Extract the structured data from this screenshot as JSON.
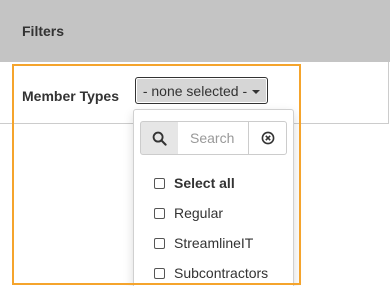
{
  "header": {
    "title": "Filters"
  },
  "filter": {
    "label": "Member Types",
    "button_text": "- none selected -"
  },
  "dropdown": {
    "search_placeholder": "Search",
    "options": [
      {
        "label": "Select all",
        "checked": false,
        "bold": true
      },
      {
        "label": "Regular",
        "checked": false
      },
      {
        "label": "StreamlineIT",
        "checked": false
      },
      {
        "label": "Subcontractors",
        "checked": false
      }
    ]
  },
  "colors": {
    "header_bg": "#c4c4c4",
    "highlight": "#f5a42c",
    "button_bg": "#d6d6d6"
  }
}
